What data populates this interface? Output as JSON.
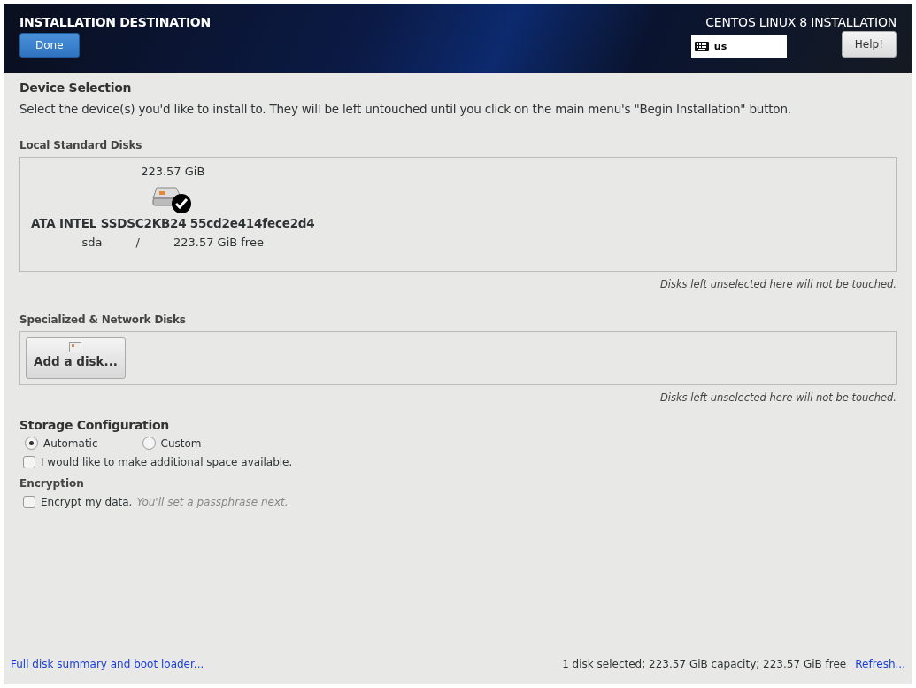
{
  "header": {
    "title": "INSTALLATION DESTINATION",
    "done": "Done",
    "product": "CENTOS LINUX 8 INSTALLATION",
    "keyboard_layout": "us",
    "help": "Help!"
  },
  "device_selection": {
    "heading": "Device Selection",
    "instructions": "Select the device(s) you'd like to install to.  They will be left untouched until you click on the main menu's \"Begin Installation\" button."
  },
  "local_disks": {
    "heading": "Local Standard Disks",
    "disks": [
      {
        "size": "223.57 GiB",
        "name": "ATA INTEL SSDSC2KB24 55cd2e414fece2d4",
        "device": "sda",
        "separator": "/",
        "free": "223.57 GiB free",
        "selected": true
      }
    ],
    "note": "Disks left unselected here will not be touched."
  },
  "specialized_disks": {
    "heading": "Specialized & Network Disks",
    "add_button": "Add a disk...",
    "note": "Disks left unselected here will not be touched."
  },
  "storage": {
    "heading": "Storage Configuration",
    "options": [
      {
        "label": "Automatic",
        "selected": true
      },
      {
        "label": "Custom",
        "selected": false
      }
    ],
    "additional_space": {
      "label": "I would like to make additional space available.",
      "checked": false
    }
  },
  "encryption": {
    "heading": "Encryption",
    "label": "Encrypt my data.",
    "hint": "You'll set a passphrase next.",
    "checked": false
  },
  "footer": {
    "summary_link": "Full disk summary and boot loader...",
    "status": "1 disk selected; 223.57 GiB capacity; 223.57 GiB free",
    "refresh_link": "Refresh..."
  }
}
